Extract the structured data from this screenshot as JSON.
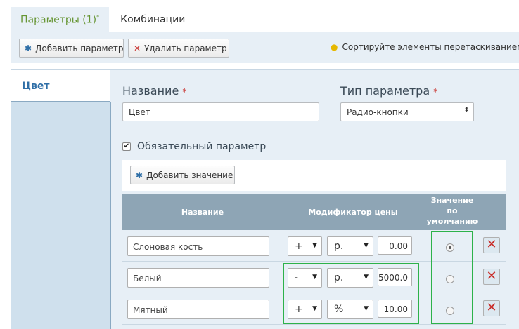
{
  "tabs": [
    {
      "label": "Параметры (1)",
      "marker": "*"
    },
    {
      "label": "Комбинации"
    }
  ],
  "toolbar": {
    "add_param": "Добавить параметр",
    "delete_param": "Удалить параметр",
    "hint": "Сортируйте элементы перетаскиванием"
  },
  "sidebar": {
    "items": [
      {
        "label": "Цвет"
      }
    ]
  },
  "form": {
    "name_label": "Название",
    "name_value": "Цвет",
    "type_label": "Тип параметра",
    "type_value": "Радио-кнопки",
    "required_marker": "*",
    "required_checkbox": "Обязательный параметр",
    "required_checked": true,
    "add_value": "Добавить значение"
  },
  "table": {
    "headers": {
      "name": "Название",
      "modifier": "Модификатор цены",
      "default_line1": "Значение",
      "default_line2": "по",
      "default_line3": "умолчанию"
    },
    "rows": [
      {
        "name": "Слоновая кость",
        "sign": "+",
        "unit": "р.",
        "amount": "0.00",
        "default": true
      },
      {
        "name": "Белый",
        "sign": "-",
        "unit": "р.",
        "amount": "5000.0",
        "default": false
      },
      {
        "name": "Мятный",
        "sign": "+",
        "unit": "%",
        "amount": "10.00",
        "default": false
      }
    ]
  },
  "colors": {
    "active_tab": "#669533",
    "accent_blue": "#2f6fa7",
    "highlight_green": "#2db24a",
    "delete_red": "#c9302c"
  }
}
